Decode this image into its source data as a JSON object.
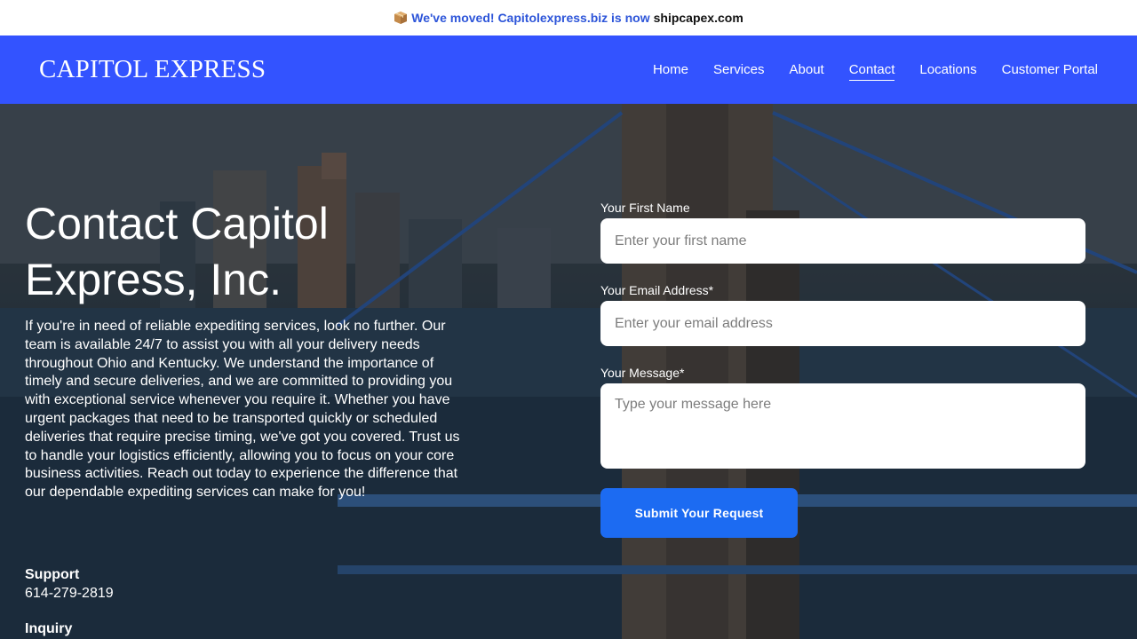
{
  "announcement": {
    "icon": "package-icon",
    "link_text": "We've moved! Capitolexpress.biz is now",
    "domain": "shipcapex.com"
  },
  "header": {
    "brand": "CAPITOL EXPRESS",
    "nav": [
      {
        "label": "Home"
      },
      {
        "label": "Services"
      },
      {
        "label": "About"
      },
      {
        "label": "Contact",
        "active": true
      },
      {
        "label": "Locations"
      },
      {
        "label": "Customer Portal"
      }
    ]
  },
  "hero": {
    "title": "Contact Capitol Express, Inc.",
    "description": "If you're in need of reliable expediting services, look no further. Our team is available 24/7 to assist you with all your delivery needs throughout Ohio and Kentucky. We understand the importance of timely and secure deliveries, and we are committed to providing you with exceptional service whenever you require it. Whether you have urgent packages that need to be transported quickly or scheduled deliveries that require precise timing, we've got you covered. Trust us to handle your logistics efficiently, allowing you to focus on your core business activities. Reach out today to experience the difference that our dependable expediting services can make for you!",
    "contacts": [
      {
        "label": "Support",
        "value": "614-279-2819"
      },
      {
        "label": "Inquiry",
        "value": ""
      }
    ]
  },
  "form": {
    "first_name_label": "Your First Name",
    "first_name_placeholder": "Enter your first name",
    "first_name_value": "",
    "email_label": "Your Email Address*",
    "email_placeholder": "Enter your email address",
    "email_value": "",
    "message_label": "Your Message*",
    "message_placeholder": "Type your message here",
    "message_value": "",
    "submit_label": "Submit Your Request"
  },
  "colors": {
    "nav_bg": "#3353ff",
    "link": "#2d55d9",
    "button": "#1c6bf2"
  }
}
